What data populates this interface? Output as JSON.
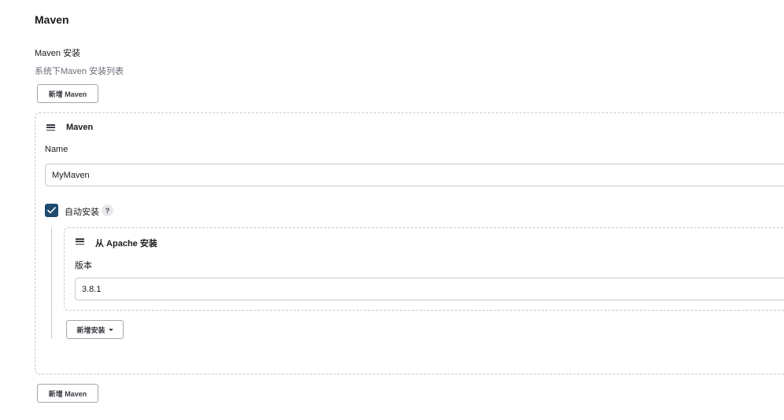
{
  "section": {
    "title": "Maven",
    "label": "Maven 安装",
    "description": "系统下Maven 安装列表",
    "add_button": "新增 Maven",
    "add_button_bottom": "新增 Maven"
  },
  "maven_card": {
    "title": "Maven",
    "name_label": "Name",
    "name_value": "MyMaven",
    "auto_install_label": "自动安装",
    "auto_install_checked": true,
    "help_text": "?"
  },
  "installer_card": {
    "title": "从 Apache 安装",
    "version_label": "版本",
    "version_value": "3.8.1",
    "add_installer_button": "新增安装"
  },
  "colors": {
    "checkbox_fill": "#1e4b6e",
    "border_dashed": "#c9c9d0",
    "muted_text": "#6c6d7a"
  }
}
